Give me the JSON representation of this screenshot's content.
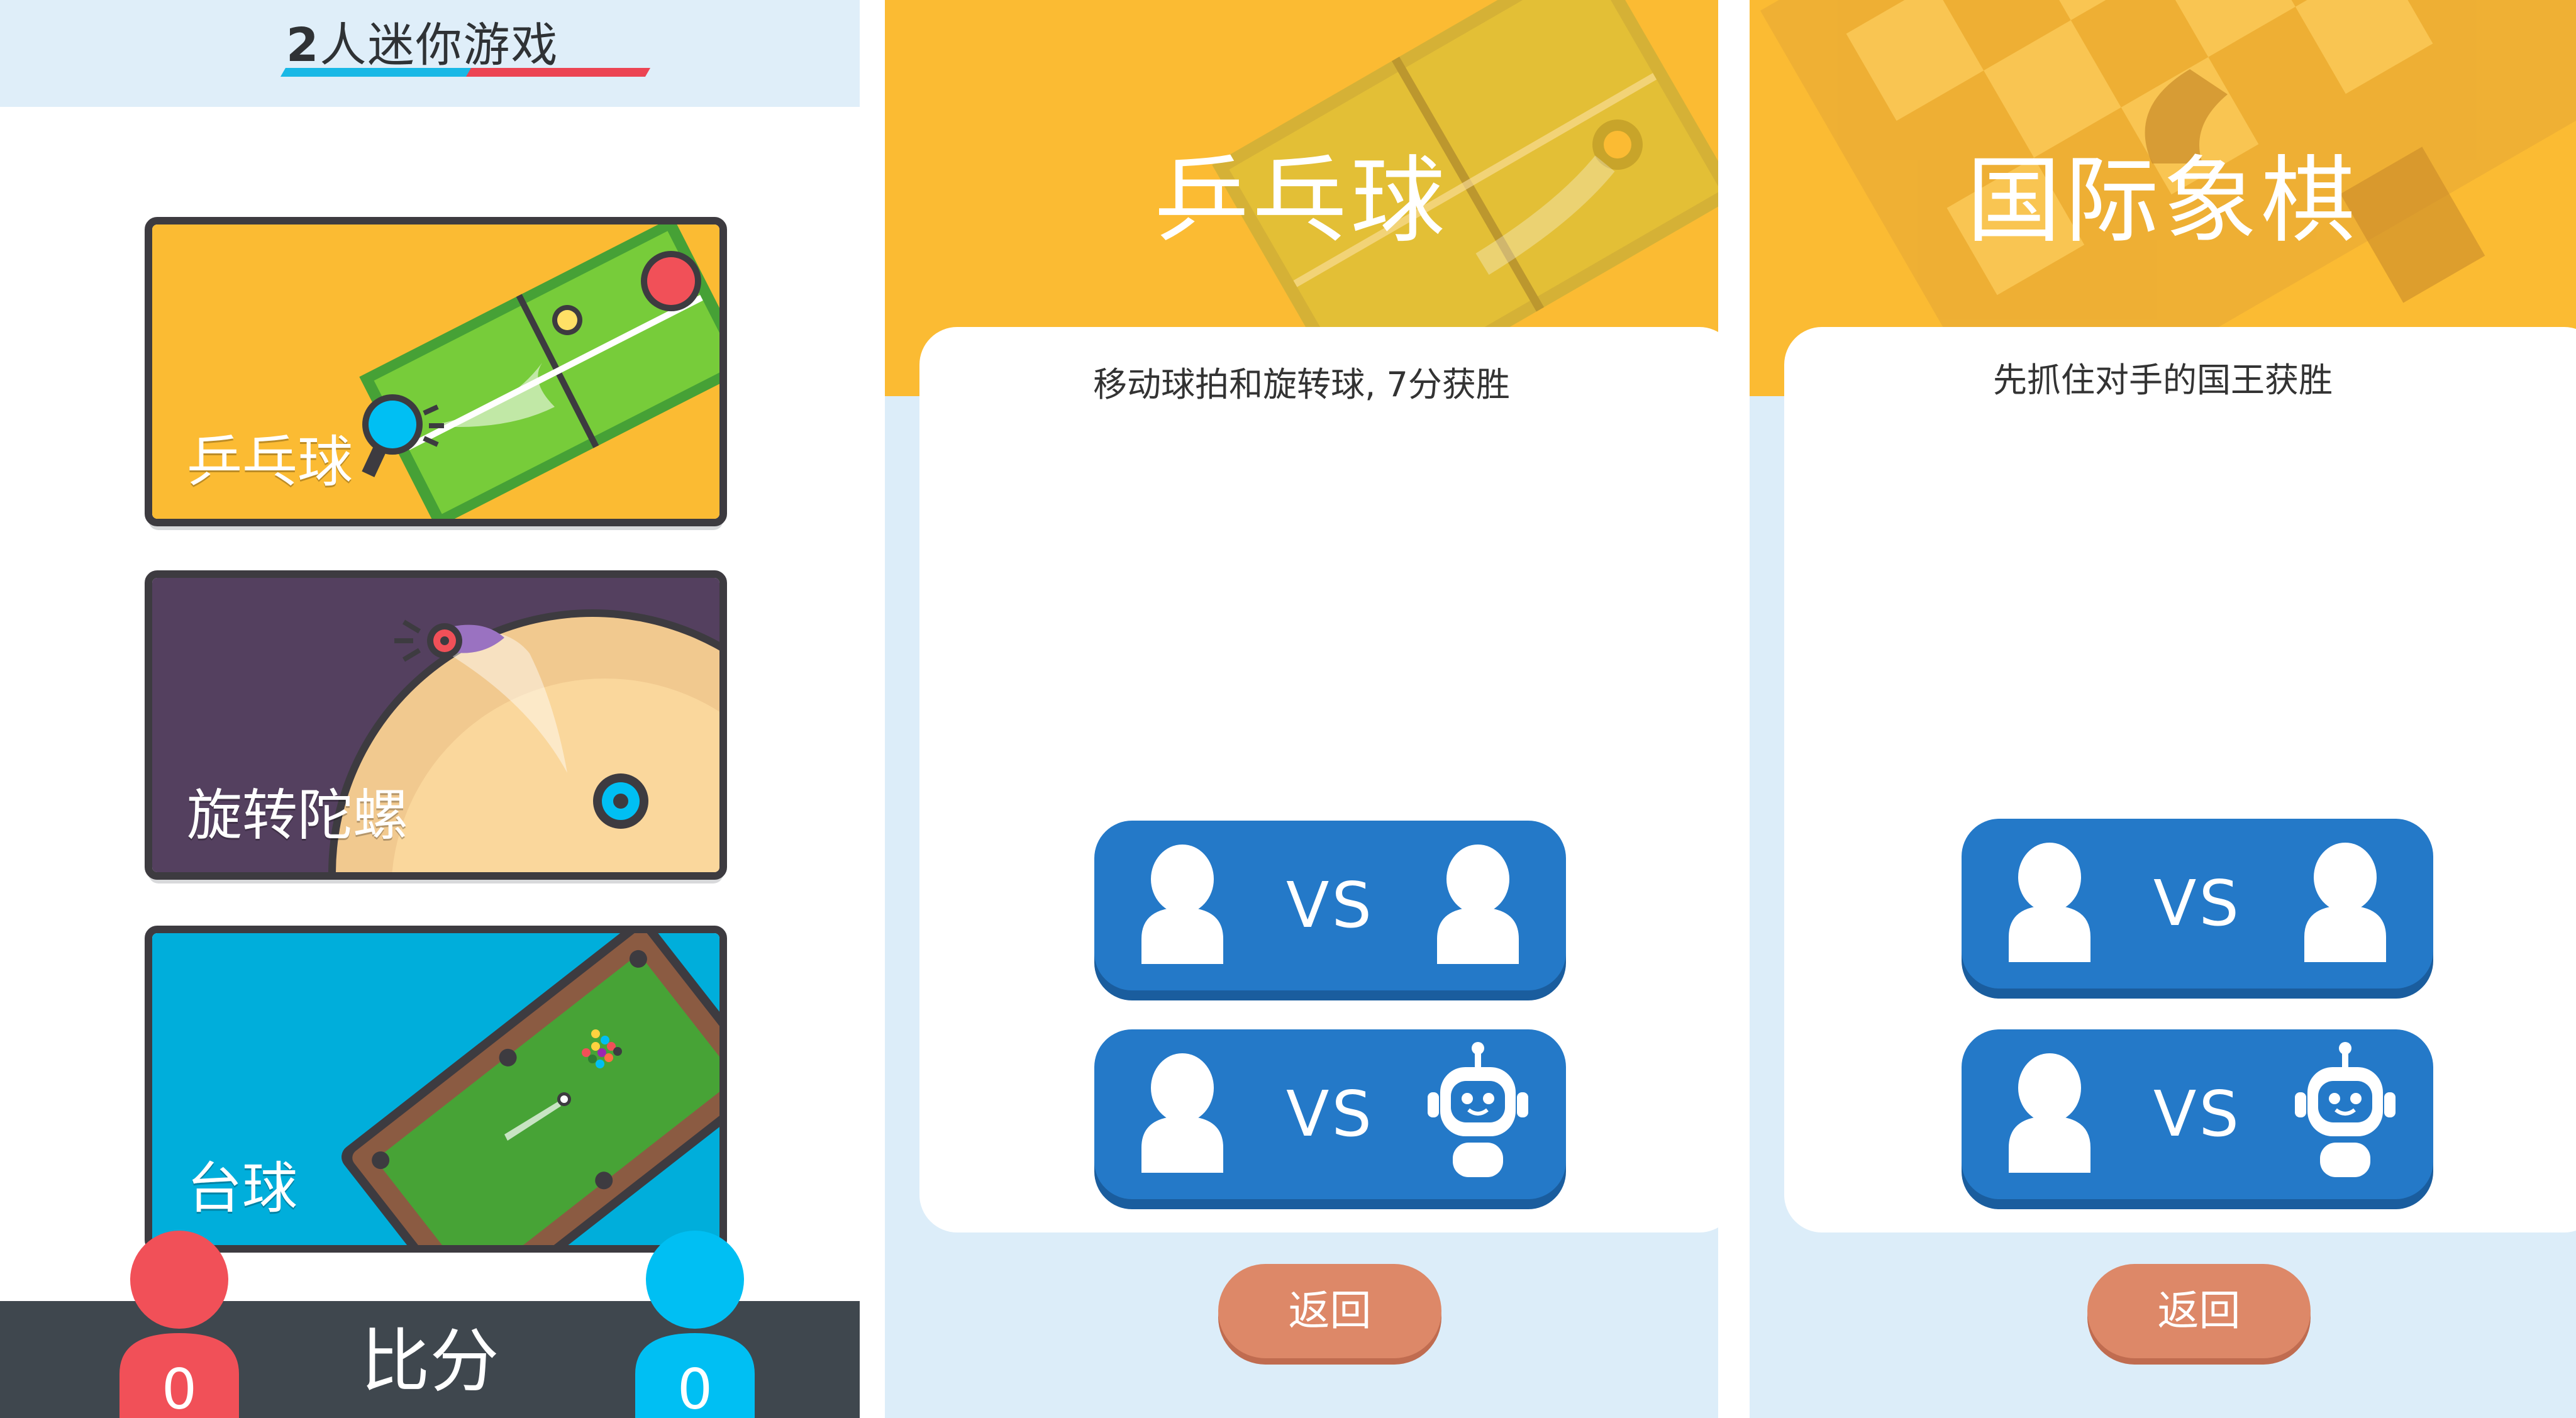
{
  "app": {
    "title_number": "2",
    "title_text": "人迷你游戏"
  },
  "menu": {
    "cards": [
      {
        "label": "乒乓球"
      },
      {
        "label": "旋转陀螺"
      },
      {
        "label": "台球"
      }
    ]
  },
  "score": {
    "label": "比分",
    "player1": "0",
    "player2": "0"
  },
  "game1": {
    "title": "乒乓球",
    "description": "移动球拍和旋转球, 7分获胜",
    "mode_pvp_vs": "VS",
    "mode_pve_vs": "VS",
    "back": "返回"
  },
  "game2": {
    "title": "国际象棋",
    "description": "先抓住对手的国王获胜",
    "mode_pvp_vs": "VS",
    "mode_pve_vs": "VS",
    "back": "返回"
  },
  "colors": {
    "accent_blue": "#2479c8",
    "red_player": "#f15058",
    "blue_player": "#00bff3",
    "hero_yellow": "#fbbb33",
    "back_button": "#dd8868"
  },
  "icons": [
    "person-icon",
    "robot-icon"
  ]
}
